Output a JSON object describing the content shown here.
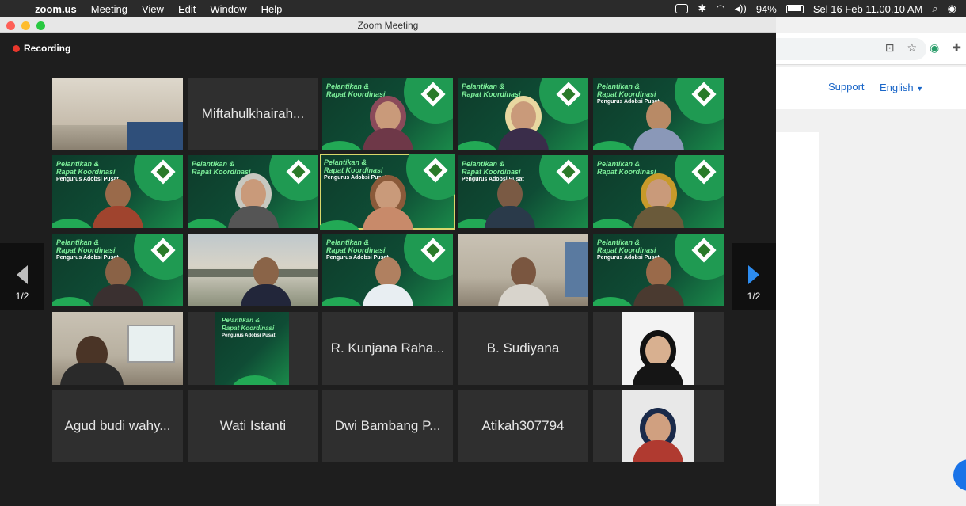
{
  "menubar": {
    "app": "zoom.us",
    "items": [
      "Meeting",
      "View",
      "Edit",
      "Window",
      "Help"
    ],
    "battery": "94%",
    "datetime": "Sel 16 Feb  11.00.10 AM"
  },
  "window": {
    "title": "Zoom Meeting"
  },
  "recording": {
    "label": "Recording"
  },
  "slide": {
    "title_line1": "Pelantikan &",
    "title_line2": "Rapat Koordinasi",
    "subtitle": "Pengurus Adobsi Pusat"
  },
  "tiles": {
    "name_1_2": "Miftahulkhairah...",
    "name_4_3": "R. Kunjana Raha...",
    "name_4_4": "B. Sudiyana",
    "name_5_1": "Agud budi wahy...",
    "name_5_2": "Wati Istanti",
    "name_5_3": "Dwi Bambang P...",
    "name_5_4": "Atikah307794"
  },
  "pager": {
    "left": "1/2",
    "right": "1/2"
  },
  "browser": {
    "support": "Support",
    "english": "English"
  },
  "colors": {
    "recording_dot": "#e8372c",
    "active_speaker": "#d9d76b",
    "nav_arrow": "#2d8cf0",
    "link": "#1a66c8"
  }
}
